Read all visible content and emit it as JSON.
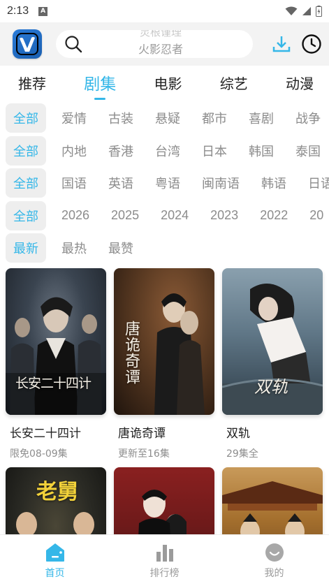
{
  "status_bar": {
    "time": "2:13",
    "a_badge": "A"
  },
  "header": {
    "search_ghost": "灵根谨理",
    "search_placeholder": "火影忍者"
  },
  "tabs": [
    {
      "label": "推荐",
      "active": false
    },
    {
      "label": "剧集",
      "active": true
    },
    {
      "label": "电影",
      "active": false
    },
    {
      "label": "综艺",
      "active": false
    },
    {
      "label": "动漫",
      "active": false
    }
  ],
  "filters": {
    "genre": [
      "全部",
      "爱情",
      "古装",
      "悬疑",
      "都市",
      "喜剧",
      "战争"
    ],
    "region": [
      "全部",
      "内地",
      "香港",
      "台湾",
      "日本",
      "韩国",
      "泰国"
    ],
    "language": [
      "全部",
      "国语",
      "英语",
      "粤语",
      "闽南语",
      "韩语",
      "日语"
    ],
    "year": [
      "全部",
      "2026",
      "2025",
      "2024",
      "2023",
      "2022",
      "20"
    ],
    "sort": [
      "最新",
      "最热",
      "最赞"
    ]
  },
  "cards": [
    {
      "title": "长安二十四计",
      "subtitle": "限免08-09集",
      "poster_text": "长安二十四计",
      "poster_colors": [
        "#3a4450",
        "#1b2027"
      ]
    },
    {
      "title": "唐诡奇谭",
      "subtitle": "更新至16集",
      "poster_text": "唐诡奇谭",
      "poster_colors": [
        "#5a3a22",
        "#1f140d"
      ]
    },
    {
      "title": "双轨",
      "subtitle": "29集全",
      "poster_text": "双轨",
      "poster_colors": [
        "#5f7686",
        "#2c3a45"
      ]
    },
    {
      "title": "",
      "subtitle": "",
      "poster_text": "老舅",
      "poster_colors": [
        "#2a2a24",
        "#121210"
      ]
    },
    {
      "title": "",
      "subtitle": "",
      "poster_text": "",
      "poster_colors": [
        "#6e1a1a",
        "#241010"
      ]
    },
    {
      "title": "",
      "subtitle": "",
      "poster_text": "",
      "poster_colors": [
        "#a5702e",
        "#4a2a12"
      ]
    }
  ],
  "bottom_nav": [
    {
      "label": "首页",
      "icon": "home-icon",
      "active": true
    },
    {
      "label": "排行榜",
      "icon": "chart-icon",
      "active": false
    },
    {
      "label": "我的",
      "icon": "smile-icon",
      "active": false
    }
  ],
  "colors": {
    "accent": "#35b7e8",
    "muted": "#8c8c8c",
    "header_bg": "#f3f3f3"
  }
}
